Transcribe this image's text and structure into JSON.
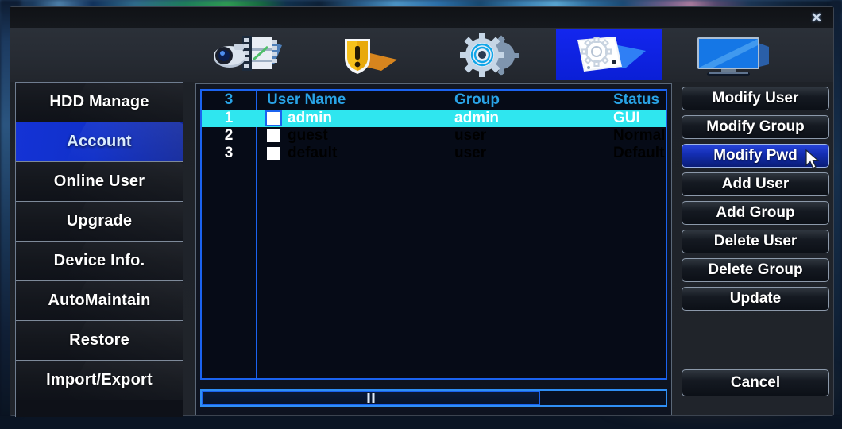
{
  "window": {
    "close_label": "✕"
  },
  "toolbar": {
    "items": [
      {
        "name": "recording-config-icon",
        "label": "Record",
        "active": false
      },
      {
        "name": "alarm-shield-icon",
        "label": "Alarm",
        "active": false
      },
      {
        "name": "gear-settings-icon",
        "label": "System",
        "active": false
      },
      {
        "name": "advanced-tools-icon",
        "label": "Advanced",
        "active": true
      },
      {
        "name": "display-monitor-icon",
        "label": "Display",
        "active": false
      }
    ]
  },
  "sidebar": {
    "items": [
      {
        "label": "HDD Manage",
        "active": false
      },
      {
        "label": "Account",
        "active": true
      },
      {
        "label": "Online User",
        "active": false
      },
      {
        "label": "Upgrade",
        "active": false
      },
      {
        "label": "Device Info.",
        "active": false
      },
      {
        "label": "AutoMaintain",
        "active": false
      },
      {
        "label": "Restore",
        "active": false
      },
      {
        "label": "Import/Export",
        "active": false
      }
    ]
  },
  "table": {
    "headers": {
      "count": "3",
      "user_name": "User Name",
      "group": "Group",
      "status": "Status"
    },
    "rows": [
      {
        "index": "1",
        "user_name": "admin",
        "group": "admin",
        "status": "GUI",
        "selected": true,
        "checked": false
      },
      {
        "index": "2",
        "user_name": "guest",
        "group": "user",
        "status": "Normal",
        "selected": false,
        "checked": false
      },
      {
        "index": "3",
        "user_name": "default",
        "group": "user",
        "status": "Default Use",
        "selected": false,
        "checked": false
      }
    ]
  },
  "actions": {
    "buttons": [
      {
        "label": "Modify User",
        "active": false
      },
      {
        "label": "Modify Group",
        "active": false
      },
      {
        "label": "Modify Pwd",
        "active": true
      },
      {
        "label": "Add User",
        "active": false
      },
      {
        "label": "Add Group",
        "active": false
      },
      {
        "label": "Delete User",
        "active": false
      },
      {
        "label": "Delete Group",
        "active": false
      },
      {
        "label": "Update",
        "active": false
      }
    ],
    "cancel_label": "Cancel"
  },
  "colors": {
    "accent_blue": "#1b63f0",
    "selection_cyan": "#2fe6ef",
    "header_blue": "#29a3e6",
    "active_nav": "#1433d6"
  }
}
